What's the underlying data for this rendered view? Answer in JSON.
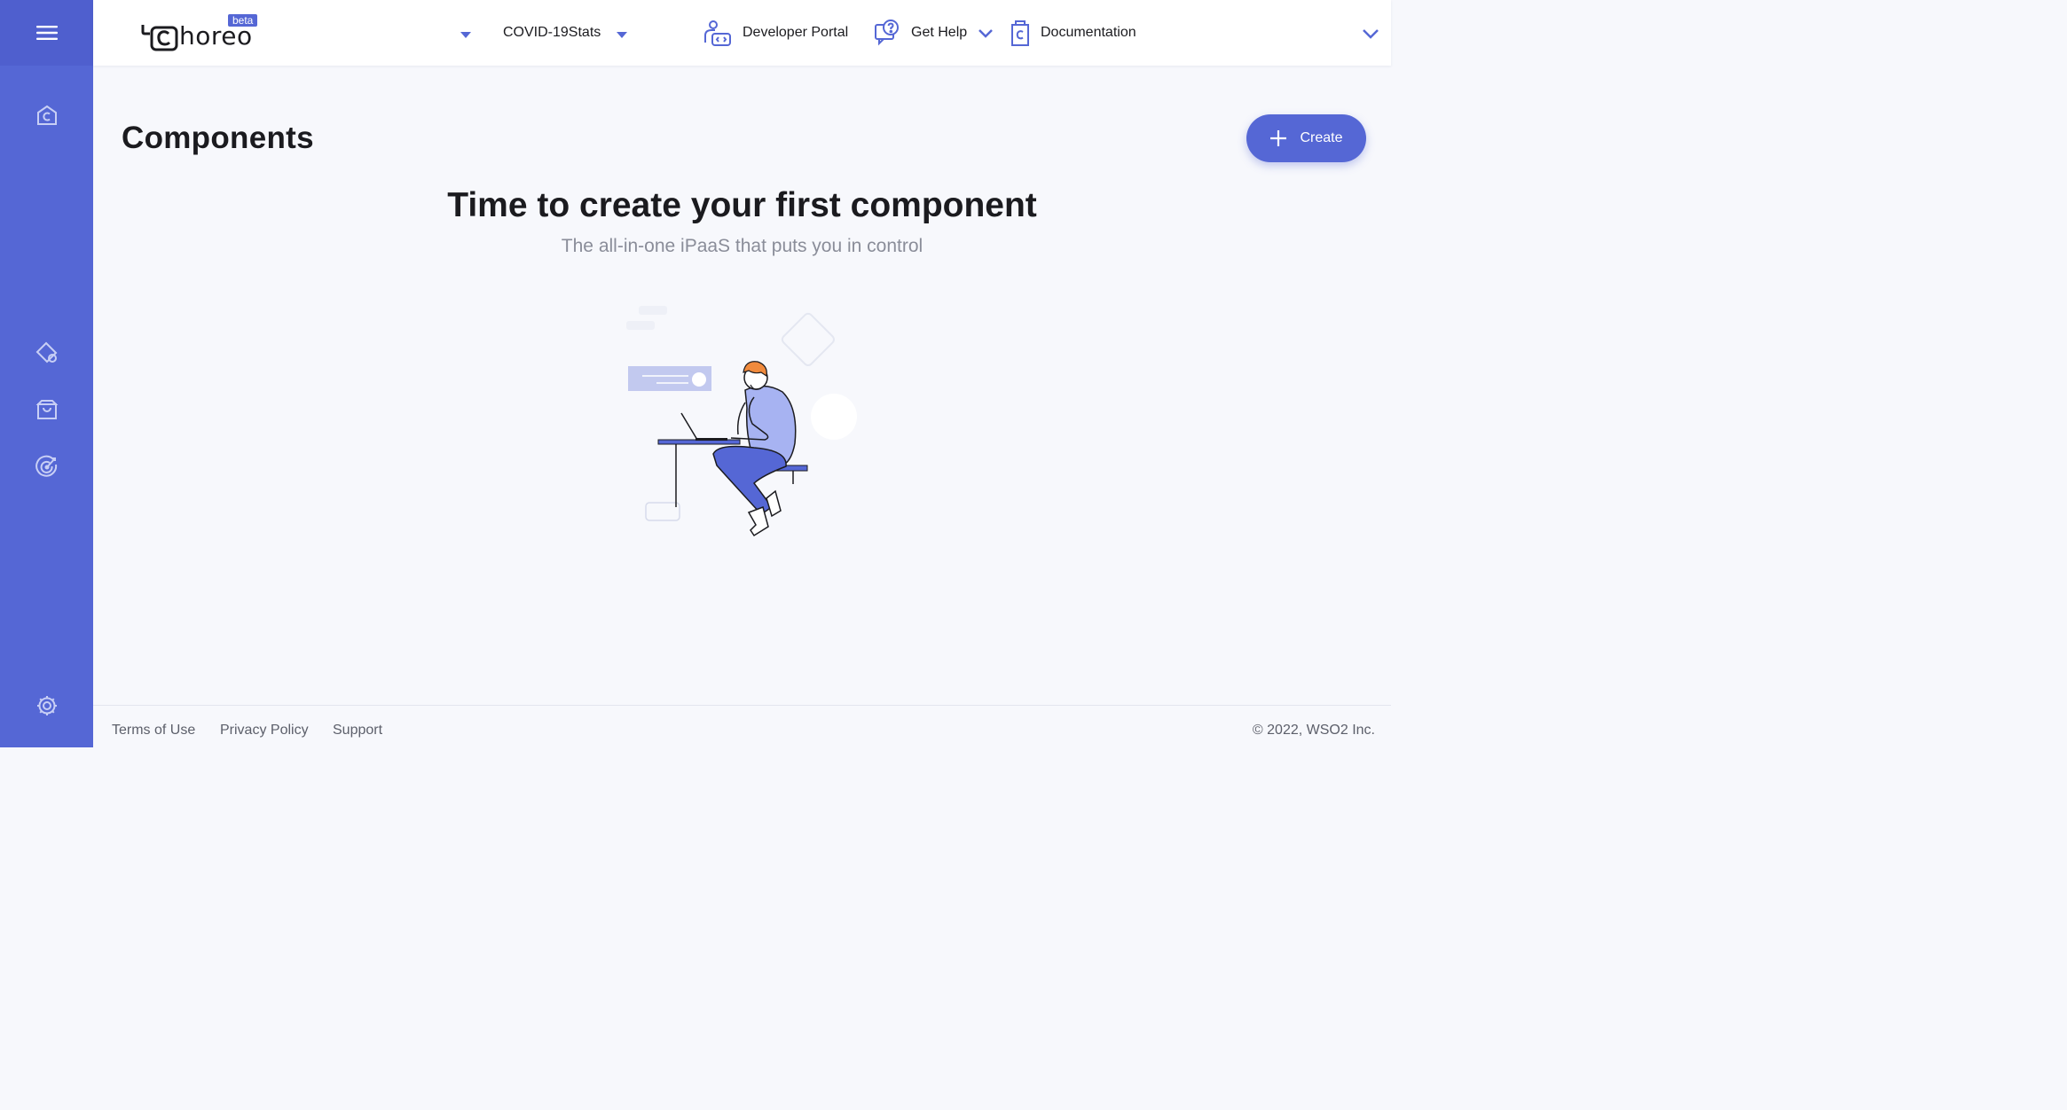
{
  "app": {
    "logo_text": "horeo",
    "logo_badge": "beta"
  },
  "sidebar": {
    "items": [
      {
        "icon": "menu-icon"
      },
      {
        "icon": "home-icon"
      },
      {
        "icon": "components-icon"
      },
      {
        "icon": "marketplace-icon"
      },
      {
        "icon": "observability-icon"
      },
      {
        "icon": "settings-icon"
      }
    ]
  },
  "header": {
    "project": "COVID-19Stats",
    "developer_portal": "Developer Portal",
    "get_help": "Get Help",
    "documentation": "Documentation"
  },
  "main": {
    "title": "Components",
    "create_label": "Create",
    "empty_title": "Time to create your first component",
    "empty_subtitle": "The all-in-one iPaaS that puts you in control"
  },
  "footer": {
    "links": [
      "Terms of Use",
      "Privacy Policy",
      "Support"
    ],
    "copyright": "©  2022, WSO2 Inc."
  },
  "colors": {
    "accent": "#5567d5",
    "background": "#f7f8fc"
  }
}
